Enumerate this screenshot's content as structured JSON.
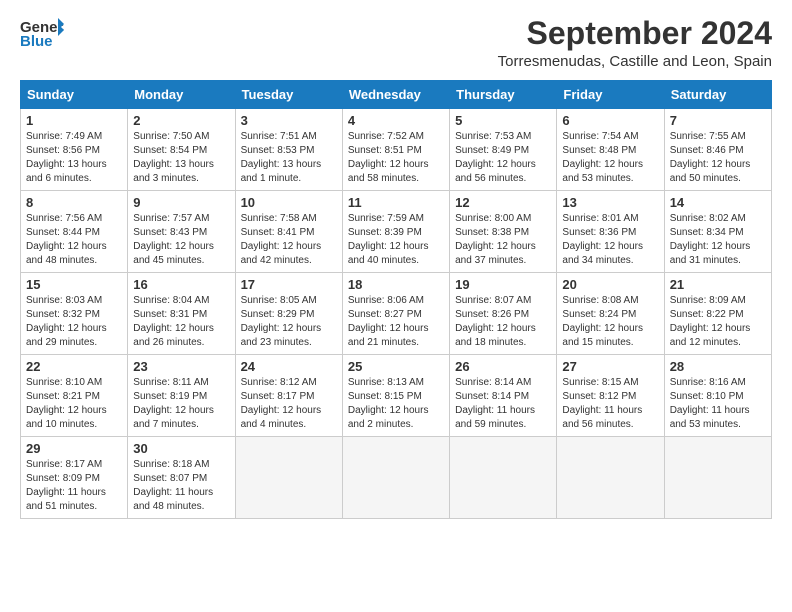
{
  "header": {
    "logo_general": "General",
    "logo_blue": "Blue",
    "month_title": "September 2024",
    "location": "Torresmenudas, Castille and Leon, Spain"
  },
  "columns": [
    "Sunday",
    "Monday",
    "Tuesday",
    "Wednesday",
    "Thursday",
    "Friday",
    "Saturday"
  ],
  "weeks": [
    [
      {
        "day": "1",
        "sunrise": "Sunrise: 7:49 AM",
        "sunset": "Sunset: 8:56 PM",
        "daylight": "Daylight: 13 hours and 6 minutes."
      },
      {
        "day": "2",
        "sunrise": "Sunrise: 7:50 AM",
        "sunset": "Sunset: 8:54 PM",
        "daylight": "Daylight: 13 hours and 3 minutes."
      },
      {
        "day": "3",
        "sunrise": "Sunrise: 7:51 AM",
        "sunset": "Sunset: 8:53 PM",
        "daylight": "Daylight: 13 hours and 1 minute."
      },
      {
        "day": "4",
        "sunrise": "Sunrise: 7:52 AM",
        "sunset": "Sunset: 8:51 PM",
        "daylight": "Daylight: 12 hours and 58 minutes."
      },
      {
        "day": "5",
        "sunrise": "Sunrise: 7:53 AM",
        "sunset": "Sunset: 8:49 PM",
        "daylight": "Daylight: 12 hours and 56 minutes."
      },
      {
        "day": "6",
        "sunrise": "Sunrise: 7:54 AM",
        "sunset": "Sunset: 8:48 PM",
        "daylight": "Daylight: 12 hours and 53 minutes."
      },
      {
        "day": "7",
        "sunrise": "Sunrise: 7:55 AM",
        "sunset": "Sunset: 8:46 PM",
        "daylight": "Daylight: 12 hours and 50 minutes."
      }
    ],
    [
      {
        "day": "8",
        "sunrise": "Sunrise: 7:56 AM",
        "sunset": "Sunset: 8:44 PM",
        "daylight": "Daylight: 12 hours and 48 minutes."
      },
      {
        "day": "9",
        "sunrise": "Sunrise: 7:57 AM",
        "sunset": "Sunset: 8:43 PM",
        "daylight": "Daylight: 12 hours and 45 minutes."
      },
      {
        "day": "10",
        "sunrise": "Sunrise: 7:58 AM",
        "sunset": "Sunset: 8:41 PM",
        "daylight": "Daylight: 12 hours and 42 minutes."
      },
      {
        "day": "11",
        "sunrise": "Sunrise: 7:59 AM",
        "sunset": "Sunset: 8:39 PM",
        "daylight": "Daylight: 12 hours and 40 minutes."
      },
      {
        "day": "12",
        "sunrise": "Sunrise: 8:00 AM",
        "sunset": "Sunset: 8:38 PM",
        "daylight": "Daylight: 12 hours and 37 minutes."
      },
      {
        "day": "13",
        "sunrise": "Sunrise: 8:01 AM",
        "sunset": "Sunset: 8:36 PM",
        "daylight": "Daylight: 12 hours and 34 minutes."
      },
      {
        "day": "14",
        "sunrise": "Sunrise: 8:02 AM",
        "sunset": "Sunset: 8:34 PM",
        "daylight": "Daylight: 12 hours and 31 minutes."
      }
    ],
    [
      {
        "day": "15",
        "sunrise": "Sunrise: 8:03 AM",
        "sunset": "Sunset: 8:32 PM",
        "daylight": "Daylight: 12 hours and 29 minutes."
      },
      {
        "day": "16",
        "sunrise": "Sunrise: 8:04 AM",
        "sunset": "Sunset: 8:31 PM",
        "daylight": "Daylight: 12 hours and 26 minutes."
      },
      {
        "day": "17",
        "sunrise": "Sunrise: 8:05 AM",
        "sunset": "Sunset: 8:29 PM",
        "daylight": "Daylight: 12 hours and 23 minutes."
      },
      {
        "day": "18",
        "sunrise": "Sunrise: 8:06 AM",
        "sunset": "Sunset: 8:27 PM",
        "daylight": "Daylight: 12 hours and 21 minutes."
      },
      {
        "day": "19",
        "sunrise": "Sunrise: 8:07 AM",
        "sunset": "Sunset: 8:26 PM",
        "daylight": "Daylight: 12 hours and 18 minutes."
      },
      {
        "day": "20",
        "sunrise": "Sunrise: 8:08 AM",
        "sunset": "Sunset: 8:24 PM",
        "daylight": "Daylight: 12 hours and 15 minutes."
      },
      {
        "day": "21",
        "sunrise": "Sunrise: 8:09 AM",
        "sunset": "Sunset: 8:22 PM",
        "daylight": "Daylight: 12 hours and 12 minutes."
      }
    ],
    [
      {
        "day": "22",
        "sunrise": "Sunrise: 8:10 AM",
        "sunset": "Sunset: 8:21 PM",
        "daylight": "Daylight: 12 hours and 10 minutes."
      },
      {
        "day": "23",
        "sunrise": "Sunrise: 8:11 AM",
        "sunset": "Sunset: 8:19 PM",
        "daylight": "Daylight: 12 hours and 7 minutes."
      },
      {
        "day": "24",
        "sunrise": "Sunrise: 8:12 AM",
        "sunset": "Sunset: 8:17 PM",
        "daylight": "Daylight: 12 hours and 4 minutes."
      },
      {
        "day": "25",
        "sunrise": "Sunrise: 8:13 AM",
        "sunset": "Sunset: 8:15 PM",
        "daylight": "Daylight: 12 hours and 2 minutes."
      },
      {
        "day": "26",
        "sunrise": "Sunrise: 8:14 AM",
        "sunset": "Sunset: 8:14 PM",
        "daylight": "Daylight: 11 hours and 59 minutes."
      },
      {
        "day": "27",
        "sunrise": "Sunrise: 8:15 AM",
        "sunset": "Sunset: 8:12 PM",
        "daylight": "Daylight: 11 hours and 56 minutes."
      },
      {
        "day": "28",
        "sunrise": "Sunrise: 8:16 AM",
        "sunset": "Sunset: 8:10 PM",
        "daylight": "Daylight: 11 hours and 53 minutes."
      }
    ],
    [
      {
        "day": "29",
        "sunrise": "Sunrise: 8:17 AM",
        "sunset": "Sunset: 8:09 PM",
        "daylight": "Daylight: 11 hours and 51 minutes."
      },
      {
        "day": "30",
        "sunrise": "Sunrise: 8:18 AM",
        "sunset": "Sunset: 8:07 PM",
        "daylight": "Daylight: 11 hours and 48 minutes."
      },
      null,
      null,
      null,
      null,
      null
    ]
  ]
}
